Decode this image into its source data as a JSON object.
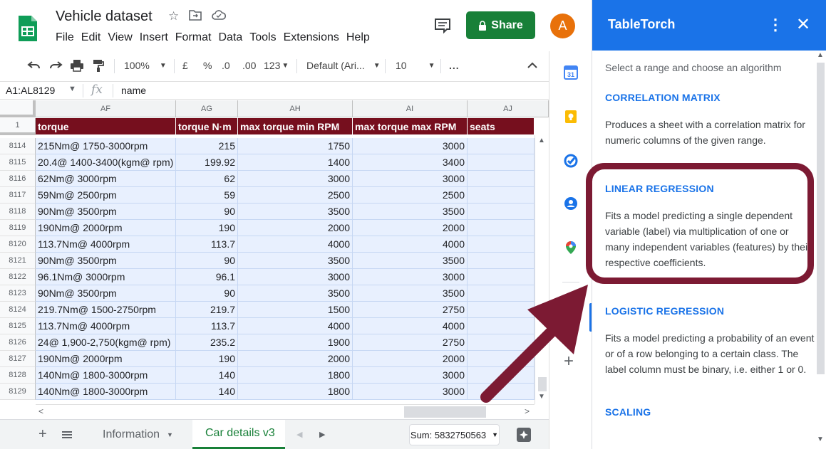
{
  "app": {
    "doc_title": "Vehicle dataset",
    "menu": [
      "File",
      "Edit",
      "View",
      "Insert",
      "Format",
      "Data",
      "Tools",
      "Extensions",
      "Help"
    ],
    "share_label": "Share",
    "avatar_letter": "A"
  },
  "toolbar": {
    "zoom": "100%",
    "currency": "£",
    "percent": "%",
    "dec_less": ".0",
    "dec_more": ".00",
    "number_format": "123",
    "font": "Default (Ari...",
    "font_size": "10",
    "more": "..."
  },
  "formula_bar": {
    "name_box": "A1:AL8129",
    "fx": "fx",
    "value": "name"
  },
  "grid": {
    "columns": [
      "AF",
      "AG",
      "AH",
      "AI",
      "AJ"
    ],
    "header_row_number": "1",
    "headers": [
      "torque",
      "torque N·m",
      "max torque min RPM",
      "max torque max RPM",
      "seats"
    ],
    "rows": [
      {
        "n": "8114",
        "c": [
          "215Nm@ 1750-3000rpm",
          "215",
          "1750",
          "3000",
          ""
        ]
      },
      {
        "n": "8115",
        "c": [
          "20.4@ 1400-3400(kgm@ rpm)",
          "199.92",
          "1400",
          "3400",
          ""
        ]
      },
      {
        "n": "8116",
        "c": [
          "62Nm@ 3000rpm",
          "62",
          "3000",
          "3000",
          ""
        ]
      },
      {
        "n": "8117",
        "c": [
          "59Nm@ 2500rpm",
          "59",
          "2500",
          "2500",
          ""
        ]
      },
      {
        "n": "8118",
        "c": [
          "90Nm@ 3500rpm",
          "90",
          "3500",
          "3500",
          ""
        ]
      },
      {
        "n": "8119",
        "c": [
          "190Nm@ 2000rpm",
          "190",
          "2000",
          "2000",
          ""
        ]
      },
      {
        "n": "8120",
        "c": [
          "113.7Nm@ 4000rpm",
          "113.7",
          "4000",
          "4000",
          ""
        ]
      },
      {
        "n": "8121",
        "c": [
          "90Nm@ 3500rpm",
          "90",
          "3500",
          "3500",
          ""
        ]
      },
      {
        "n": "8122",
        "c": [
          "96.1Nm@ 3000rpm",
          "96.1",
          "3000",
          "3000",
          ""
        ]
      },
      {
        "n": "8123",
        "c": [
          "90Nm@ 3500rpm",
          "90",
          "3500",
          "3500",
          ""
        ]
      },
      {
        "n": "8124",
        "c": [
          "219.7Nm@ 1500-2750rpm",
          "219.7",
          "1500",
          "2750",
          ""
        ]
      },
      {
        "n": "8125",
        "c": [
          "113.7Nm@ 4000rpm",
          "113.7",
          "4000",
          "4000",
          ""
        ]
      },
      {
        "n": "8126",
        "c": [
          "24@ 1,900-2,750(kgm@ rpm)",
          "235.2",
          "1900",
          "2750",
          ""
        ]
      },
      {
        "n": "8127",
        "c": [
          "190Nm@ 2000rpm",
          "190",
          "2000",
          "2000",
          ""
        ]
      },
      {
        "n": "8128",
        "c": [
          "140Nm@ 1800-3000rpm",
          "140",
          "1800",
          "3000",
          ""
        ]
      },
      {
        "n": "8129",
        "c": [
          "140Nm@ 1800-3000rpm",
          "140",
          "1800",
          "3000",
          ""
        ]
      }
    ]
  },
  "sheets": {
    "tabs": [
      "Information",
      "Car details v3"
    ],
    "active": "Car details v3",
    "sum_label": "Sum: 5832750563"
  },
  "panel": {
    "title": "TableTorch",
    "intro": "Select a range and choose an algorithm",
    "algorithms": [
      {
        "title": "CORRELATION MATRIX",
        "desc": "Produces a sheet with a correlation matrix for numeric columns of the given range."
      },
      {
        "title": "LINEAR REGRESSION",
        "desc": "Fits a model predicting a single dependent variable (label) via multiplication of one or many independent variables (features) by their respective coefficients."
      },
      {
        "title": "LOGISTIC REGRESSION",
        "desc": "Fits a model predicting a probability of an event or of a row belonging to a certain class. The label column must be binary, i.e. either 1 or 0."
      },
      {
        "title": "SCALING",
        "desc": ""
      }
    ]
  },
  "colors": {
    "brand_green": "#188038",
    "panel_blue": "#1a73e8",
    "header_maroon": "#760f1e",
    "annotation": "#7c1a33"
  }
}
